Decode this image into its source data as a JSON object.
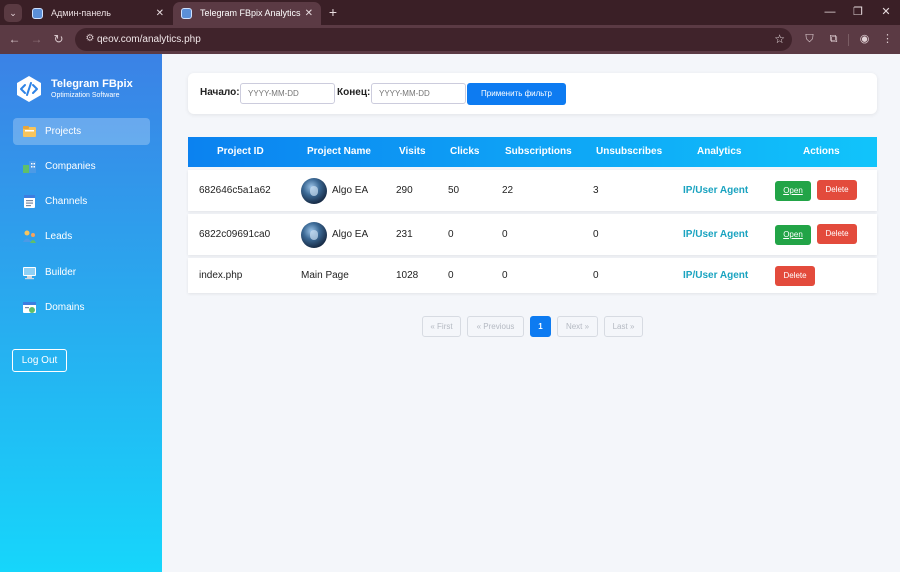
{
  "browser": {
    "tabs": [
      {
        "title": "Админ-панель",
        "active": false
      },
      {
        "title": "Telegram FBpix Analytics",
        "active": true
      }
    ],
    "url": "qeov.com/analytics.php"
  },
  "sidebar": {
    "brand_title": "Telegram FBpix",
    "brand_subtitle": "Optimization Software",
    "items": [
      {
        "label": "Projects",
        "icon": "projects-icon",
        "active": true
      },
      {
        "label": "Companies",
        "icon": "companies-icon",
        "active": false
      },
      {
        "label": "Channels",
        "icon": "channels-icon",
        "active": false
      },
      {
        "label": "Leads",
        "icon": "leads-icon",
        "active": false
      },
      {
        "label": "Builder",
        "icon": "builder-icon",
        "active": false
      },
      {
        "label": "Domains",
        "icon": "domains-icon",
        "active": false
      }
    ],
    "logout_label": "Log Out"
  },
  "filter": {
    "start_label": "Начало:",
    "start_placeholder": "YYYY-MM-DD",
    "end_label": "Конец:",
    "end_placeholder": "YYYY-MM-DD",
    "apply_label": "Применить фильтр"
  },
  "table": {
    "headers": [
      "Project ID",
      "Project Name",
      "Visits",
      "Clicks",
      "Subscriptions",
      "Unsubscribes",
      "Analytics",
      "Actions"
    ],
    "rows": [
      {
        "id": "682646c5a1a62",
        "name": "Algo EA",
        "visits": "290",
        "clicks": "50",
        "subscriptions": "22",
        "unsubscribes": "3",
        "analytics": "IP/User Agent",
        "open": "Open",
        "delete": "Delete"
      },
      {
        "id": "6822c09691ca0",
        "name": "Algo EA",
        "visits": "231",
        "clicks": "0",
        "subscriptions": "0",
        "unsubscribes": "0",
        "analytics": "IP/User Agent",
        "open": "Open",
        "delete": "Delete"
      },
      {
        "id": "index.php",
        "name": "Main Page",
        "visits": "1028",
        "clicks": "0",
        "subscriptions": "0",
        "unsubscribes": "0",
        "analytics": "IP/User Agent",
        "delete": "Delete"
      }
    ]
  },
  "pagination": {
    "first": "« First",
    "previous": "« Previous",
    "current": "1",
    "next": "Next »",
    "last": "Last »"
  },
  "colors": {
    "accent": "#0d7bf1",
    "open_button": "#22a447",
    "delete_button": "#e34b3c",
    "analytics_link": "#1aa3c0"
  }
}
